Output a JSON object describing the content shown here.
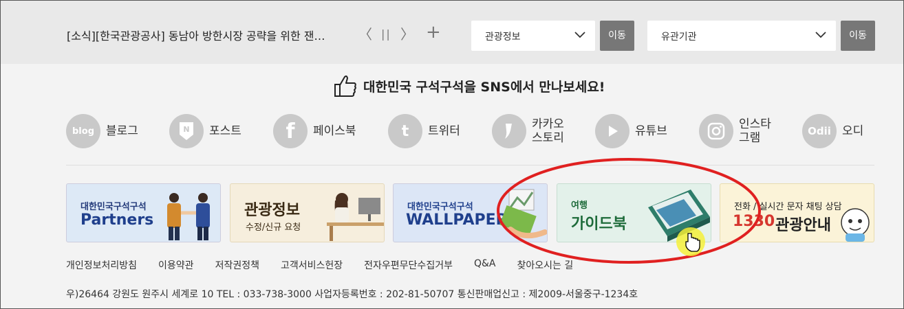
{
  "topbar": {
    "news": "[소식][한국관광공사] 동남아 방한시장 공략을 위한 잰…",
    "controls": {
      "prev": "〈",
      "pause": "||",
      "next": "〉",
      "add": "+"
    },
    "select1": {
      "value": "관광정보",
      "button": "이동"
    },
    "select2": {
      "value": "유관기관",
      "button": "이동"
    }
  },
  "sns": {
    "heading": "대한민국 구석구석을 SNS에서 만나보세요!",
    "items": [
      {
        "icon": "blog",
        "label": "블로그"
      },
      {
        "icon": "N",
        "label": "포스트"
      },
      {
        "icon": "f",
        "label": "페이스북"
      },
      {
        "icon": "t",
        "label": "트위터"
      },
      {
        "icon": "kakao",
        "label1": "카카오",
        "label2": "스토리"
      },
      {
        "icon": "youtube",
        "label": "유튜브"
      },
      {
        "icon": "instagram",
        "label1": "인스타",
        "label2": "그램"
      },
      {
        "icon": "Odii",
        "label": "오디"
      }
    ]
  },
  "banners": [
    {
      "small": "대한민국구석구석",
      "big": "Partners"
    },
    {
      "big": "관광정보",
      "small": "수정/신규 요청"
    },
    {
      "small": "대한민국구석구석",
      "big": "WALLPAPER"
    },
    {
      "small": "여행",
      "big": "가이드북"
    },
    {
      "small": "전화 / 실시간 문자 채팅 상담",
      "big_num": "1330",
      "big": "관광안내"
    }
  ],
  "footer": {
    "links": [
      "개인정보처리방침",
      "이용약관",
      "저작권정책",
      "고객서비스헌장",
      "전자우편무단수집거부",
      "Q&A",
      "찾아오시는 길"
    ],
    "address": "우)26464  강원도 원주시 세계로 10   TEL : 033-738-3000   사업자등록번호 : 202-81-50707   통신판매업신고 : 제2009-서울중구-1234호"
  },
  "colors": {
    "annotation": "#e02020",
    "cursor_highlight": "#f4f03a",
    "button_gray": "#777777"
  }
}
